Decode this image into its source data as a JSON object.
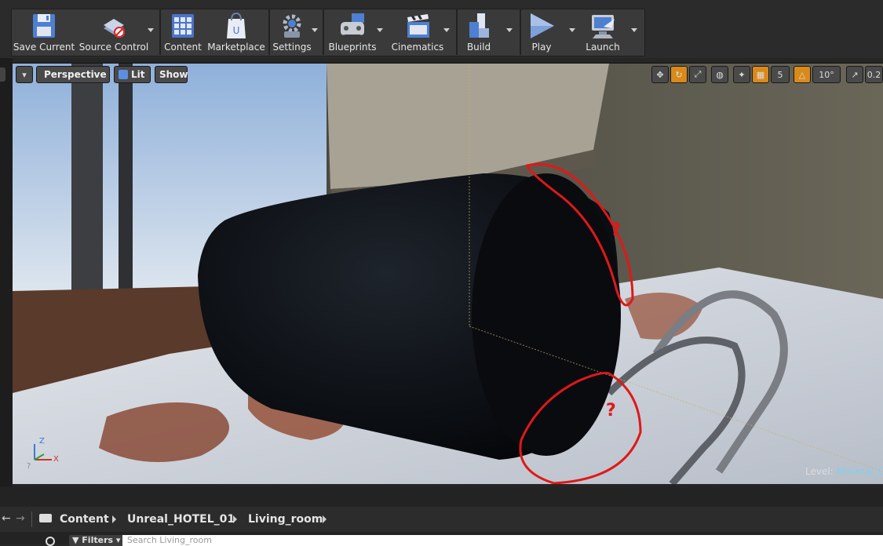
{
  "toolbar": {
    "buttons": [
      {
        "label": "Save Current",
        "icon": "floppy-disk-icon"
      },
      {
        "label": "Source Control",
        "icon": "source-control-icon"
      },
      {
        "label": "Content",
        "icon": "content-grid-icon"
      },
      {
        "label": "Marketplace",
        "icon": "marketplace-bag-icon"
      },
      {
        "label": "Settings",
        "icon": "gear-icon"
      },
      {
        "label": "Blueprints",
        "icon": "gamepad-icon"
      },
      {
        "label": "Cinematics",
        "icon": "clapperboard-icon"
      },
      {
        "label": "Build",
        "icon": "build-blocks-icon"
      },
      {
        "label": "Play",
        "icon": "play-icon"
      },
      {
        "label": "Launch",
        "icon": "launch-monitor-icon"
      }
    ]
  },
  "viewport": {
    "view_mode": "Perspective",
    "lighting": "Lit",
    "show": "Show",
    "grid_snap": "5",
    "rotation_snap": "10°",
    "scale_snap": "0.2",
    "level_label": "Level:",
    "level_name": "Minimal_De",
    "annotation_marks": [
      "?",
      "?"
    ]
  },
  "content_browser": {
    "breadcrumb": [
      "Content",
      "Unreal_HOTEL_01",
      "Living_room"
    ],
    "filters_label": "Filters",
    "search_placeholder": "Search Living_room"
  },
  "colors": {
    "accent_orange": "#d98a1a",
    "annotation_red": "#e01818",
    "level_name": "#7fd0f0"
  }
}
